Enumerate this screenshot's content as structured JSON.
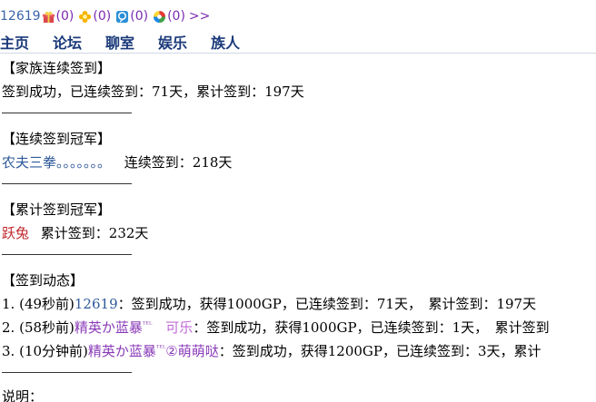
{
  "top": {
    "user_id": "12619",
    "counts": [
      "(0)",
      "(0)",
      "(0)",
      "(0)"
    ],
    "icons": [
      "gift-icon",
      "flower-icon",
      "chat-bubble-icon",
      "colorwheel-icon"
    ],
    "more": ">>"
  },
  "nav": [
    "主页",
    "论坛",
    "聊室",
    "娱乐",
    "族人"
  ],
  "family_checkin": {
    "heading": "【家族连续签到】",
    "text": "签到成功，已连续签到：71天，累计签到：197天"
  },
  "streak_champion": {
    "heading": "【连续签到冠军】",
    "name": "农夫三拳。。。。。。。",
    "text": "连续签到：218天"
  },
  "total_champion": {
    "heading": "【累计签到冠军】",
    "name": "跃兔",
    "text": "累计签到：232天"
  },
  "activity": {
    "heading": "【签到动态】",
    "items": [
      {
        "index": "1.",
        "time": "(49秒前)",
        "user": "12619",
        "msg": "：签到成功，获得1000GP，已连续签到：71天，　累计签到：197天"
      },
      {
        "index": "2.",
        "time": "(58秒前)",
        "user": "精英か蓝暴",
        "user_suffix": "ᵀᴱᴸ",
        "user_tail": "　可乐",
        "msg": "：签到成功，获得1000GP，已连续签到：1天，　累计签到"
      },
      {
        "index": "3.",
        "time": "(10分钟前)",
        "user": "精英か蓝暴",
        "user_suffix": "ᵀᴱᴸ",
        "user_tail": "②萌萌哒",
        "msg": "：签到成功，获得1200GP，已连续签到：3天，累计"
      }
    ]
  },
  "footer": {
    "label": "说明："
  },
  "colors": {
    "link_blue": "#2f5a9a",
    "nav_blue": "#1b3a7a",
    "count_purple": "#7b2bb0",
    "name_red": "#c0262b",
    "name_violet": "#8a3bb8",
    "name_pink": "#c06ad6"
  }
}
